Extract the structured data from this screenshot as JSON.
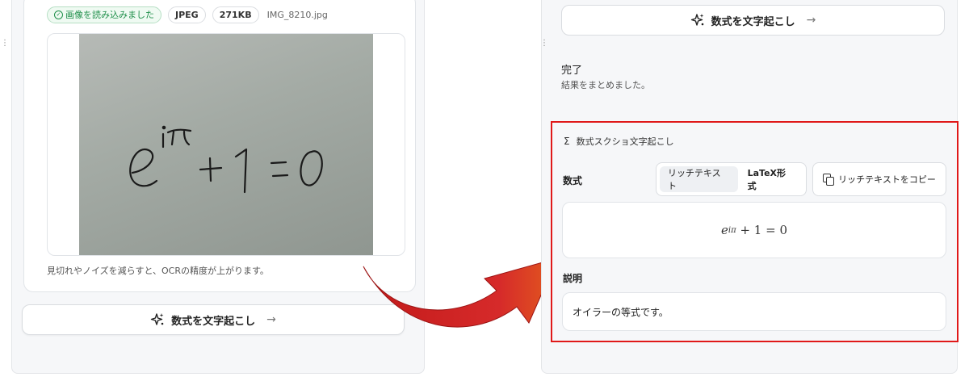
{
  "left": {
    "tags": {
      "loaded": "画像を読み込みました",
      "format": "JPEG",
      "size": "271KB",
      "filename": "IMG_8210.jpg"
    },
    "photo_formula": "e^{iπ} + 1 = 0",
    "hint": "見切れやノイズを減らすと、OCRの精度が上がります。",
    "transcribe_button": "数式を文字起こし",
    "icons": {
      "ok": "check-circle-icon",
      "sparkle": "sparkle-icon",
      "arrow": "arrow-right-icon"
    }
  },
  "right": {
    "transcribe_button": "数式を文字起こし",
    "status_title": "完了",
    "status_subtitle": "結果をまとめました。",
    "result": {
      "section_title": "数式スクショ文字起こし",
      "section_icon": "Σ",
      "formula_label": "数式",
      "tabs": [
        "リッチテキスト",
        "LaTeX形式"
      ],
      "active_tab": "リッチテキスト",
      "copy_button": "リッチテキストをコピー",
      "formula_base": "e",
      "formula_exp": "iπ",
      "formula_rest": "+ 1 = 0",
      "description_label": "説明",
      "description": "オイラーの等式です。"
    }
  },
  "colors": {
    "highlight_border": "#e01919",
    "arrow_red": "#d22222",
    "success_green": "#1f8f4a"
  }
}
